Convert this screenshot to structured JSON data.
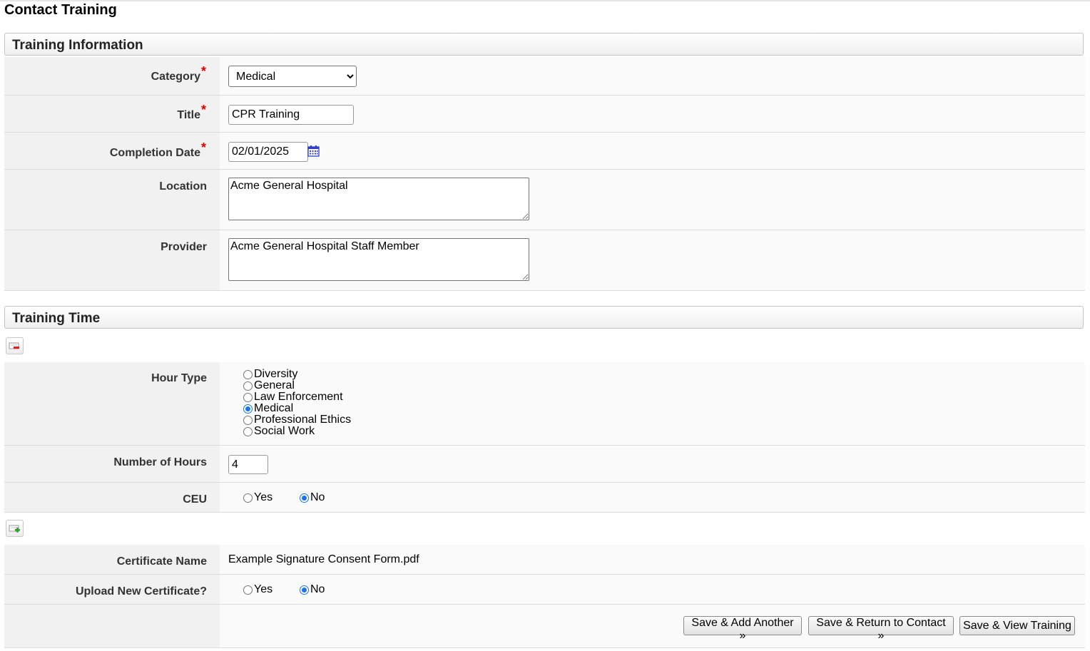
{
  "page": {
    "title": "Contact Training"
  },
  "training_information": {
    "header": "Training Information",
    "category": {
      "label": "Category",
      "value": "Medical",
      "required": true
    },
    "title": {
      "label": "Title",
      "value": "CPR Training",
      "required": true
    },
    "completion_date": {
      "label": "Completion Date",
      "value": "02/01/2025",
      "required": true,
      "icon": "calendar-icon"
    },
    "location": {
      "label": "Location",
      "value": "Acme General Hospital"
    },
    "provider": {
      "label": "Provider",
      "value": "Acme General Hospital Staff Member"
    }
  },
  "training_time": {
    "header": "Training Time",
    "remove_icon": "remove-row-icon",
    "hour_type": {
      "label": "Hour Type",
      "options": [
        "Diversity",
        "General",
        "Law Enforcement",
        "Medical",
        "Professional Ethics",
        "Social Work"
      ],
      "selected": "Medical"
    },
    "number_of_hours": {
      "label": "Number of Hours",
      "value": "4"
    },
    "ceu": {
      "label": "CEU",
      "yes": "Yes",
      "no": "No",
      "selected": "No"
    },
    "add_icon": "add-row-icon"
  },
  "certificate": {
    "name_label": "Certificate Name",
    "name_value": "Example Signature Consent Form.pdf",
    "upload_label": "Upload New Certificate?",
    "upload_yes": "Yes",
    "upload_no": "No",
    "upload_selected": "No"
  },
  "actions": {
    "save_add_another": "Save & Add Another »",
    "save_return_contact": "Save & Return to Contact »",
    "save_view_training": "Save & View Training"
  },
  "colors": {
    "required": "#e00000",
    "radio_selected": "#1a73e8",
    "calendar": "#2b3fd6"
  }
}
